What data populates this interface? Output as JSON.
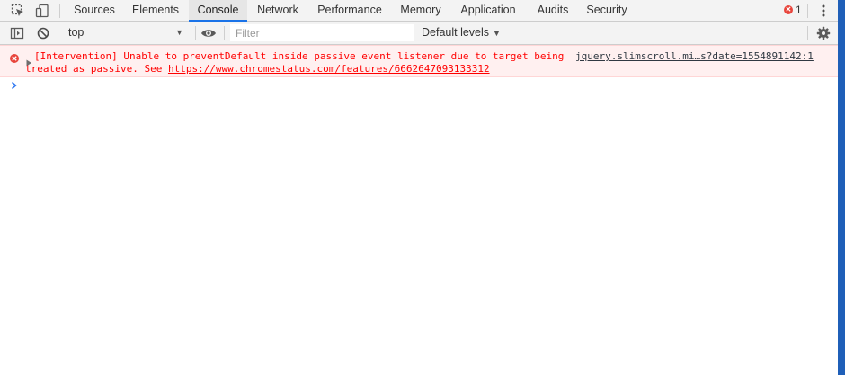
{
  "tabs": [
    {
      "label": "Sources",
      "active": false
    },
    {
      "label": "Elements",
      "active": false
    },
    {
      "label": "Console",
      "active": true
    },
    {
      "label": "Network",
      "active": false
    },
    {
      "label": "Performance",
      "active": false
    },
    {
      "label": "Memory",
      "active": false
    },
    {
      "label": "Application",
      "active": false
    },
    {
      "label": "Audits",
      "active": false
    },
    {
      "label": "Security",
      "active": false
    }
  ],
  "error_count": "1",
  "toolbar": {
    "context": "top",
    "filter_placeholder": "Filter",
    "levels_label": "Default levels"
  },
  "messages": [
    {
      "level": "error",
      "line1": "[Intervention] Unable to preventDefault inside passive event listener due to target being",
      "line2_prefix": "treated as passive. See ",
      "link": "https://www.chromestatus.com/features/6662647093133312",
      "source": "jquery.slimscroll.mi…s?date=1554891142:1"
    }
  ],
  "icons": {
    "inspect": "inspect-element-icon",
    "device": "device-toggle-icon",
    "menu": "kebab-menu-icon",
    "sidebar": "sidebar-toggle-icon",
    "clear": "clear-console-icon",
    "eye": "live-expression-icon",
    "settings": "gear-icon",
    "prompt": "chevron-right-icon"
  },
  "colors": {
    "accent": "#1a73e8",
    "error": "#ff0000",
    "error_bg": "#fff0f0",
    "window_border": "#1f5fb8"
  }
}
